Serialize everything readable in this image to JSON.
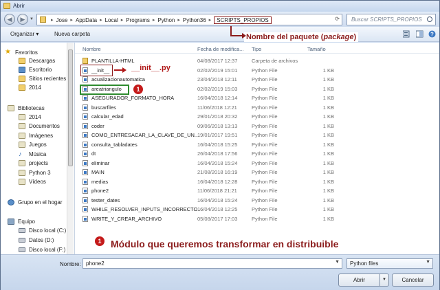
{
  "window": {
    "title": "Abrir"
  },
  "address": {
    "crumbs": [
      "Jose",
      "AppData",
      "Local",
      "Programs",
      "Python",
      "Python36",
      "SCRIPTS_PROPIOS"
    ],
    "search_placeholder": "Buscar SCRIPTS_PROPIOS"
  },
  "toolbar": {
    "organize": "Organizar ▾",
    "new_folder": "Nueva carpeta"
  },
  "annotations": {
    "package_prefix": "Nombre del paquete (",
    "package_word": "package",
    "package_suffix": ")",
    "init_label": "__init__.py",
    "module_label": "Módulo que queremos transformar en distribuible",
    "badge": "1"
  },
  "sidebar": {
    "favorites": {
      "label": "Favoritos",
      "items": [
        "Descargas",
        "Escritorio",
        "Sitios recientes",
        "2014"
      ]
    },
    "libraries": {
      "label": "Bibliotecas",
      "items": [
        "2014",
        "Documentos",
        "Imágenes",
        "Juegos",
        "Música",
        "projects",
        "Python 3",
        "Vídeos"
      ]
    },
    "homegroup": "Grupo en el hogar",
    "computer": {
      "label": "Equipo",
      "items": [
        "Disco local (C:)",
        "Datos (D:)",
        "Disco local (F:)"
      ]
    }
  },
  "columns": {
    "name": "Nombre",
    "date": "Fecha de modifica...",
    "type": "Tipo",
    "size": "Tamaño"
  },
  "files": [
    {
      "name": "PLANTILLA-HTML",
      "date": "04/08/2017 12:37",
      "type": "Carpeta de archivos",
      "size": "",
      "kind": "folder"
    },
    {
      "name": "__init__",
      "date": "02/02/2019 15:01",
      "type": "Python File",
      "size": "1 KB",
      "kind": "py"
    },
    {
      "name": "acualizacionautomatica",
      "date": "23/04/2018 12:11",
      "type": "Python File",
      "size": "1 KB",
      "kind": "py"
    },
    {
      "name": "areatriangulo",
      "date": "02/02/2019 15:03",
      "type": "Python File",
      "size": "1 KB",
      "kind": "py"
    },
    {
      "name": "ASEGURADOR_FORMATO_HORA",
      "date": "16/04/2018 12:14",
      "type": "Python File",
      "size": "1 KB",
      "kind": "py"
    },
    {
      "name": "buscarfiles",
      "date": "11/06/2018 12:21",
      "type": "Python File",
      "size": "1 KB",
      "kind": "py"
    },
    {
      "name": "calcular_edad",
      "date": "29/01/2018 20:32",
      "type": "Python File",
      "size": "1 KB",
      "kind": "py"
    },
    {
      "name": "coder",
      "date": "09/06/2018 13:13",
      "type": "Python File",
      "size": "1 KB",
      "kind": "py"
    },
    {
      "name": "COMO_ENTRESACAR_LA_CLAVE_DE_UN...",
      "date": "19/01/2017 19:51",
      "type": "Python File",
      "size": "1 KB",
      "kind": "py"
    },
    {
      "name": "consulta_tabladates",
      "date": "16/04/2018 15:25",
      "type": "Python File",
      "size": "1 KB",
      "kind": "py"
    },
    {
      "name": "dt",
      "date": "26/04/2018 17:56",
      "type": "Python File",
      "size": "1 KB",
      "kind": "py"
    },
    {
      "name": "eliminar",
      "date": "16/04/2018 15:24",
      "type": "Python File",
      "size": "1 KB",
      "kind": "py"
    },
    {
      "name": "MAIN",
      "date": "21/08/2018 16:19",
      "type": "Python File",
      "size": "1 KB",
      "kind": "py"
    },
    {
      "name": "medias",
      "date": "16/04/2018 12:28",
      "type": "Python File",
      "size": "1 KB",
      "kind": "py"
    },
    {
      "name": "phone2",
      "date": "11/06/2018 21:21",
      "type": "Python File",
      "size": "1 KB",
      "kind": "py"
    },
    {
      "name": "tester_dates",
      "date": "16/04/2018 15:24",
      "type": "Python File",
      "size": "1 KB",
      "kind": "py"
    },
    {
      "name": "WHILE_RESOLVER_INPUTS_INCORRECTO...",
      "date": "16/04/2018 12:25",
      "type": "Python File",
      "size": "1 KB",
      "kind": "py"
    },
    {
      "name": "WRITE_Y_CREAR_ARCHIVO",
      "date": "05/08/2017 17:03",
      "type": "Python File",
      "size": "1 KB",
      "kind": "py"
    }
  ],
  "bottom": {
    "name_label": "Nombre:",
    "name_value": "phone2",
    "filter_value": "Python files",
    "open_button": "Abrir",
    "cancel_button": "Cancelar"
  }
}
